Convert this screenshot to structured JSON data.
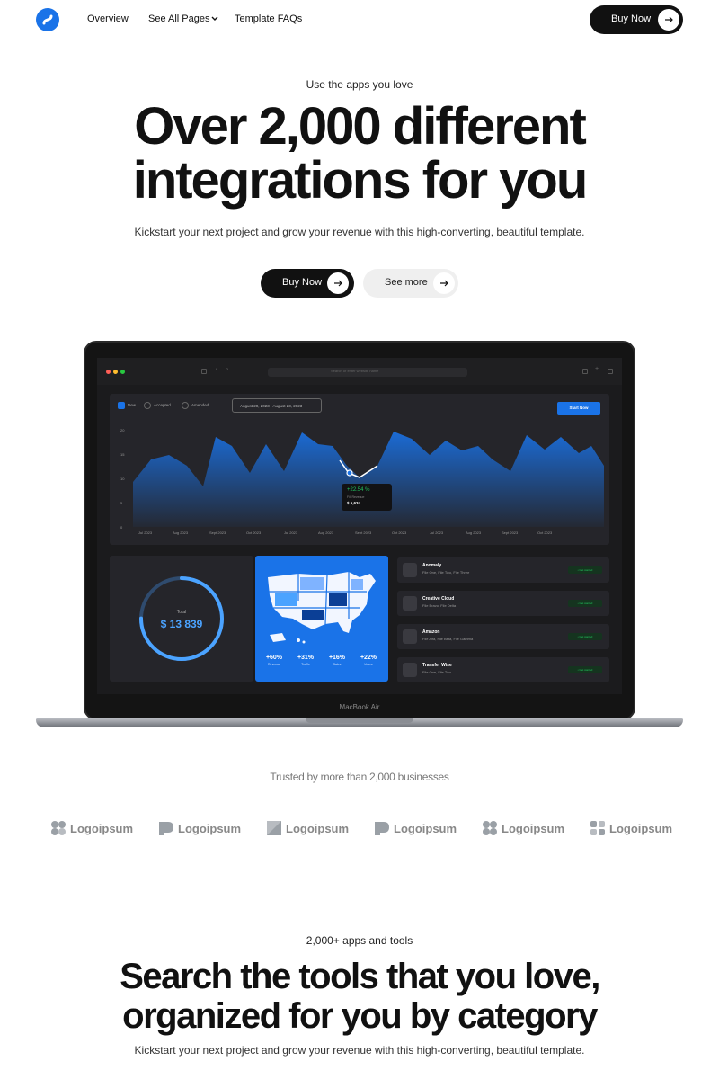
{
  "nav": {
    "links": [
      "Overview",
      "See All Pages",
      "Template FAQs"
    ],
    "buy_label": "Buy Now"
  },
  "hero": {
    "eyebrow": "Use the apps you love",
    "title_line1": "Over 2,000 different",
    "title_line2": "integrations for you",
    "subtitle": "Kickstart your next project and grow your revenue with this high-converting, beautiful template.",
    "primary_cta": "Buy Now",
    "secondary_cta": "See more"
  },
  "laptop": {
    "model_label": "MacBook Air",
    "url_placeholder": "Search or enter website name",
    "dashboard": {
      "filters": [
        "New",
        "Accepted",
        "Amended"
      ],
      "date_range": "August 20, 2023 - August 23, 2023",
      "start_button": "Start Now",
      "y_ticks": [
        "20",
        "15",
        "10",
        "5",
        "0"
      ],
      "x_ticks": [
        "Jul 2023",
        "Aug 2023",
        "Sept 2023",
        "Oct 2023",
        "Jul 2023",
        "Aug 2023",
        "Sept 2023",
        "Oct 2023",
        "Jul 2023",
        "Aug 2023",
        "Sept 2023",
        "Oct 2023"
      ],
      "tooltip": {
        "pct": "+22.54 %",
        "label": "Fill Revenue",
        "amount": "$ 5,634"
      },
      "donut": {
        "label": "Total",
        "value": "$ 13 839",
        "fraction": 0.75
      },
      "stats": [
        {
          "value": "+60%",
          "label": "Revenue"
        },
        {
          "value": "+31%",
          "label": "Traffic"
        },
        {
          "value": "+16%",
          "label": "Sales"
        },
        {
          "value": "+22%",
          "label": "Users"
        }
      ],
      "apps": [
        {
          "name": "Anomaly",
          "files": "File One, File Two, File Three",
          "badge": "• Get started"
        },
        {
          "name": "Creative Cloud",
          "files": "File Bravo, File Delta",
          "badge": "• Get started"
        },
        {
          "name": "Amazon",
          "files": "File Alfa, File Beta, File Gamma",
          "badge": "• Get started"
        },
        {
          "name": "Transfer Wise",
          "files": "File One, File Two",
          "badge": "• Get started"
        }
      ]
    }
  },
  "trusted": {
    "text": "Trusted by more than 2,000 businesses",
    "brands": [
      "Logoipsum",
      "Logoipsum",
      "Logoipsum",
      "Logoipsum",
      "Logoipsum",
      "Logoipsum"
    ]
  },
  "section2": {
    "eyebrow": "2,000+ apps and tools",
    "title_line1": "Search the tools that you love,",
    "title_line2": "organized for you by category",
    "subtitle": "Kickstart your next project and grow your revenue with this high-converting, beautiful template."
  },
  "colors": {
    "accent": "#1a73e8",
    "dark": "#111111",
    "success": "#22c55e"
  }
}
